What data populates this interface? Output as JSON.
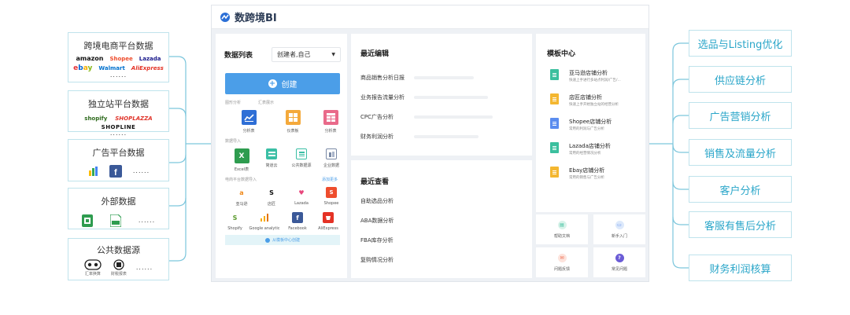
{
  "colors": {
    "accent": "#2aa6c9",
    "primary_button": "#4b9ee8",
    "box_border": "#bfe3ec"
  },
  "sources": [
    {
      "title": "跨境电商平台数据",
      "logos": [
        "amazon",
        "Shopee",
        "Lazada",
        "ebay",
        "Walmart",
        "AliExpress"
      ],
      "more": "......"
    },
    {
      "title": "独立站平台数据",
      "logos": [
        "shopify",
        "SHOPLAZZA",
        "SHOPLINE"
      ],
      "more": "......"
    },
    {
      "title": "广告平台数据",
      "icons": [
        "google-ads-icon",
        "facebook-icon"
      ],
      "more": "......"
    },
    {
      "title": "外部数据",
      "icons": [
        "excel-file-icon",
        "csv-file-icon"
      ],
      "more": "......"
    },
    {
      "title": "公共数据源",
      "items": [
        "汇率换算",
        "财税报表"
      ],
      "more": "......"
    }
  ],
  "categories": [
    "选品与Listing优化",
    "供应链分析",
    "广告营销分析",
    "销售及流量分析",
    "客户分析",
    "客服有售后分析",
    "财务利润核算"
  ],
  "app": {
    "brand": "数跨境BI",
    "data_list": {
      "title": "数据列表",
      "filter_value": "创建者,自己",
      "create_label": "创建",
      "sections": {
        "chart_analysis": "图形分析",
        "dashboard": "汇表展示",
        "data_import": "数据导入",
        "platform_import": "电商平台数据导入",
        "more": "添加更多"
      },
      "analysis_items": [
        "分析表",
        "仪表板",
        "分析表"
      ],
      "import_items": [
        "Excel表",
        "简道云",
        "公共数据源",
        "企业数据"
      ],
      "platform_items": [
        "亚马逊",
        "店匠",
        "Lazada",
        "Shopee",
        "Shopify",
        "Google analytic",
        "Facebook",
        "AliExpress"
      ],
      "footer": "从模板中心创建"
    },
    "recent_edit": {
      "title": "最近编辑",
      "items": [
        "商品销售分析日报",
        "业务报告流量分析",
        "CPC广告分析",
        "财务利润分析"
      ]
    },
    "recent_view": {
      "title": "最近查看",
      "items": [
        "自助选品分析",
        "ABA数据分析",
        "FBA库存分析",
        "复购情况分析"
      ]
    },
    "templates": {
      "title": "模板中心",
      "items": [
        {
          "name": "亚马逊店铺分析",
          "desc": "快速上手进行多站点利润/广告/...",
          "color": "#3bbf9e"
        },
        {
          "name": "店匠店铺分析",
          "desc": "快速上手开始独立站的经营分析",
          "color": "#f4b731"
        },
        {
          "name": "Shopee店铺分析",
          "desc": "常用的利润与广告分析",
          "color": "#5b8def"
        },
        {
          "name": "Lazada店铺分析",
          "desc": "常用的经营情况分析",
          "color": "#3bbf9e"
        },
        {
          "name": "Ebay店铺分析",
          "desc": "常用的销售与广告分析",
          "color": "#f4b731"
        }
      ]
    },
    "help": [
      "帮助文档",
      "新手入门",
      "问题反馈",
      "常见问题"
    ]
  }
}
